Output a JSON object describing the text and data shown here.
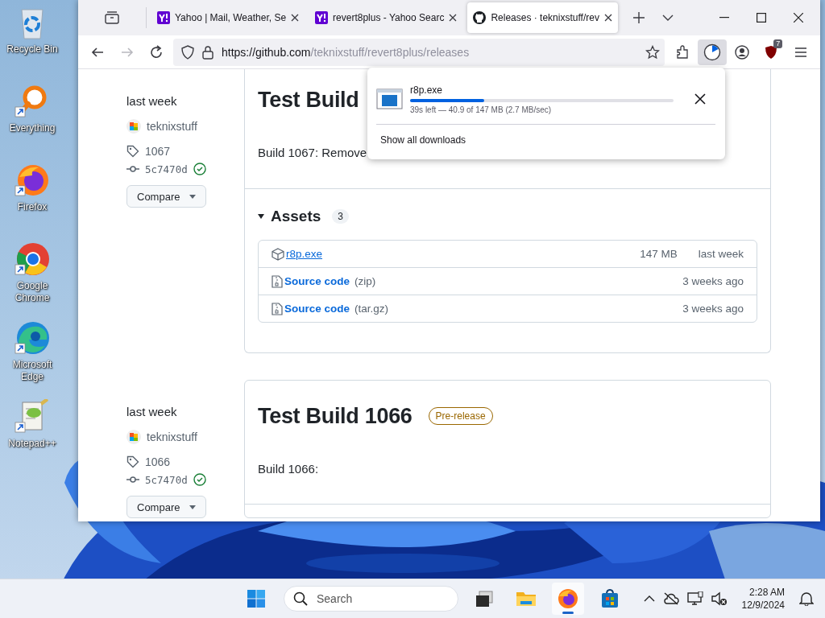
{
  "desktop_icons": [
    {
      "kind": "recycle",
      "label": "Recycle Bin"
    },
    {
      "kind": "everything",
      "label": "Everything"
    },
    {
      "kind": "firefox",
      "label": "Firefox"
    },
    {
      "kind": "chrome",
      "label": "Google Chrome"
    },
    {
      "kind": "edge",
      "label": "Microsoft Edge"
    },
    {
      "kind": "notepad",
      "label": "Notepad++"
    }
  ],
  "browser": {
    "tabs": [
      {
        "kind": "yahoo",
        "title": "Yahoo | Mail, Weather, Se",
        "selected": false
      },
      {
        "kind": "yahoo",
        "title": "revert8plus - Yahoo Searc",
        "selected": false
      },
      {
        "kind": "github",
        "title": "Releases · teknixstuff/rev",
        "selected": true
      }
    ],
    "navigation": [
      {
        "kind": "back",
        "disabled": false
      },
      {
        "kind": "forward",
        "disabled": true
      },
      {
        "kind": "reload",
        "disabled": false
      }
    ],
    "url_host": "https://github.com",
    "url_path": "/teknixstuff/revert8plus/releases",
    "extension_badge": "7",
    "releases": [
      {
        "date": "last week",
        "author": "teknixstuff",
        "tag": "1067",
        "commit": "5c7470d",
        "compare": "Compare",
        "title": "Test Build",
        "description": "Build 1067: Remove",
        "assets": {
          "title": "Assets",
          "count": "3",
          "items": [
            {
              "kind": "package",
              "name": "r8p.exe",
              "hovered": true,
              "size": "147 MB",
              "date": "last week"
            },
            {
              "kind": "archive",
              "name": "Source code",
              "format": "(zip)",
              "hovered": false,
              "date": "3 weeks ago"
            },
            {
              "kind": "archive",
              "name": "Source code",
              "format": "(tar.gz)",
              "hovered": false,
              "date": "3 weeks ago"
            }
          ]
        }
      },
      {
        "date": "last week",
        "author": "teknixstuff",
        "tag": "1066",
        "commit": "5c7470d",
        "compare": "Compare",
        "title": "Test Build 1066",
        "badge": "Pre-release",
        "description": "Build 1066:"
      }
    ],
    "download": {
      "file": "r8p.exe",
      "level": 0.28,
      "status": "39s left — 40.9 of 147 MB (2.7 MB/sec)",
      "footer": "Show all downloads"
    }
  },
  "taskbar": {
    "search_placeholder": "Search",
    "apps": [
      {
        "kind": "taskview",
        "active": false
      },
      {
        "kind": "explorer",
        "active": false
      },
      {
        "kind": "firefox",
        "active": true
      },
      {
        "kind": "store",
        "active": false
      }
    ],
    "time": "2:28 AM",
    "date": "12/9/2024"
  }
}
